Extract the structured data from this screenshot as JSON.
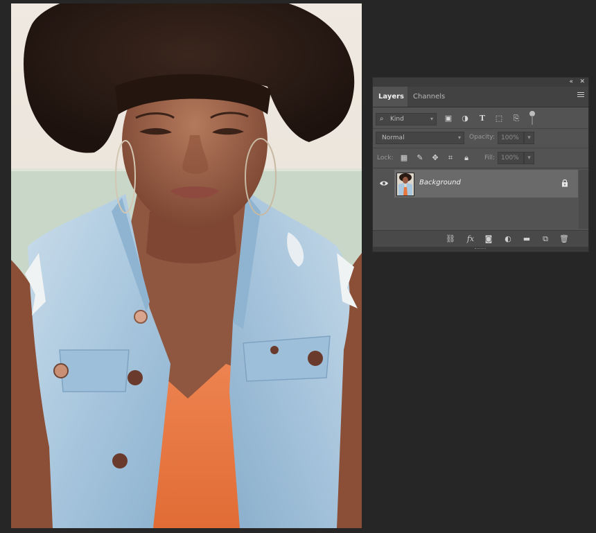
{
  "photo": {
    "subject": "woman-in-denim-vest",
    "colors": {
      "wall_top": "#ece6dd",
      "wall_band": "#c7d6c8",
      "hair": "#2a1a14",
      "skin": "#9a5e45",
      "denim": "#b3cee2",
      "shirt": "#e7773f"
    }
  },
  "panel": {
    "collapse_glyph": "«",
    "close_glyph": "✕",
    "tabs": [
      {
        "label": "Layers"
      },
      {
        "label": "Channels"
      }
    ],
    "filter": {
      "kind_label": "Kind",
      "kind_icon": "search-icon"
    },
    "blend_mode": "Normal",
    "opacity_label": "Opacity:",
    "opacity_value": "100%",
    "lock_label": "Lock:",
    "fill_label": "Fill:",
    "fill_value": "100%",
    "layers": [
      {
        "name": "Background",
        "visible": true,
        "locked": true
      }
    ],
    "bottom_icons": [
      "link-icon",
      "fx-icon",
      "mask-icon",
      "adjustment-icon",
      "folder-icon",
      "new-layer-icon",
      "trash-icon"
    ],
    "fx_label": "fx"
  }
}
